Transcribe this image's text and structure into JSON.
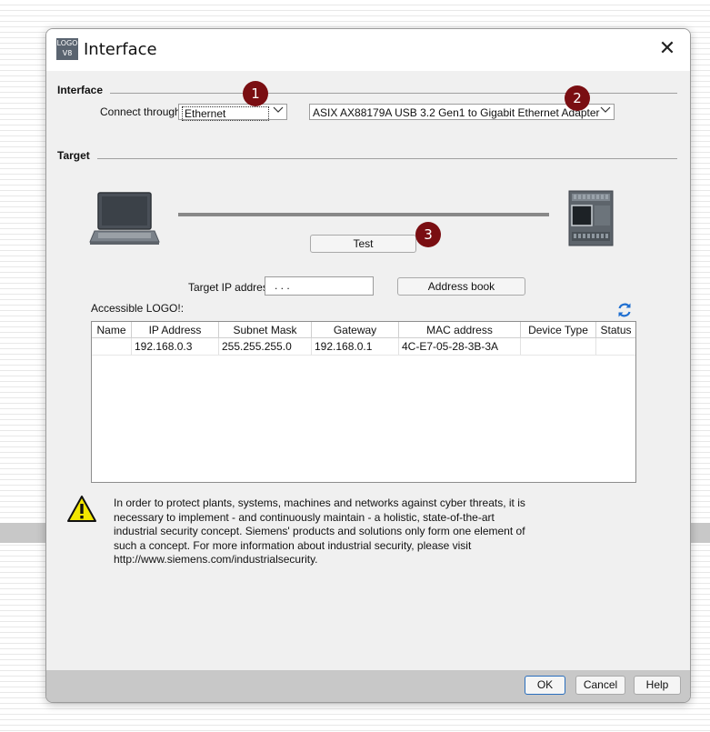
{
  "window": {
    "title": "Interface",
    "app_icon_text_top": "LOGO",
    "app_icon_text_bottom": "V8",
    "close_label": "✕"
  },
  "interface_group": {
    "label": "Interface",
    "connect_through_label": "Connect through:",
    "connect_through_value": "Ethernet",
    "adapter_value": "ASIX AX88179A USB 3.2 Gen1 to Gigabit Ethernet Adapter"
  },
  "badges": [
    "1",
    "2",
    "3"
  ],
  "target_group": {
    "label": "Target",
    "test_button": "Test",
    "target_ip_label": "Target IP address:",
    "target_ip_value": " .   .   . ",
    "address_book_button": "Address book",
    "accessible_label": "Accessible LOGO!:",
    "refresh_icon": "refresh-icon"
  },
  "table": {
    "columns": [
      "Name",
      "IP Address",
      "Subnet Mask",
      "Gateway",
      "MAC address",
      "Device Type",
      "Status"
    ],
    "rows": [
      {
        "name": "",
        "ip": "192.168.0.3",
        "subnet": "255.255.255.0",
        "gateway": "192.168.0.1",
        "mac": "4C-E7-05-28-3B-3A",
        "device_type": "",
        "status": ""
      }
    ]
  },
  "warning": {
    "icon": "warning-icon",
    "text": "In order to protect plants, systems, machines and networks against cyber threats, it is necessary to implement - and continuously maintain - a holistic, state-of-the-art industrial security concept. Siemens' products and solutions only form one element of such a concept. For more information about industrial security, please visit http://www.siemens.com/industrialsecurity."
  },
  "footer": {
    "ok": "OK",
    "cancel": "Cancel",
    "help": "Help"
  },
  "colors": {
    "badge": "#7a0e12",
    "dialog_bg": "#f0f0f0",
    "footer_bg": "#c8c8c8",
    "default_button_border": "#2a6ebd"
  }
}
